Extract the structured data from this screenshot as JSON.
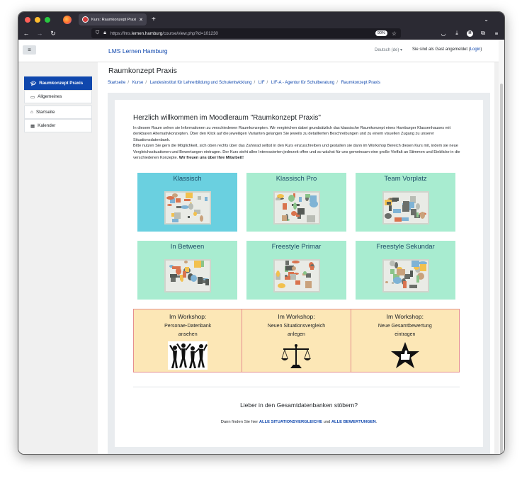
{
  "browser": {
    "tab_title": "Kurs: Raumkonzept Praxis",
    "url_prefix": "https://lms.",
    "url_domain": "lernen.hamburg",
    "url_suffix": "/course/view.php?id=101230",
    "zoom": "90%",
    "profile_initial": "M"
  },
  "header": {
    "site_name": "LMS Lernen Hamburg",
    "language": "Deutsch (de) ▾",
    "guest_text": "Sie sind als Gast angemeldet (",
    "login_label": "Login",
    "guest_close": ")"
  },
  "sidebar": {
    "items": [
      {
        "label": "Raumkonzept Praxis",
        "icon": "graduation-cap-icon"
      },
      {
        "label": "Allgemeines",
        "icon": "folder-icon"
      },
      {
        "label": "Startseite",
        "icon": "home-icon"
      },
      {
        "label": "Kalender",
        "icon": "calendar-icon"
      }
    ]
  },
  "page": {
    "title": "Raumkonzept Praxis",
    "breadcrumbs": [
      "Startseite",
      "Kurse",
      "Landesinstitut für Lehrerbildung und Schulentwicklung",
      "LIF",
      "LIF-A - Agentur für Schulberatung",
      "Raumkonzept Praxis"
    ]
  },
  "content": {
    "welcome_title": "Herzlich willkommen im Moodleraum \"Raumkonzept Praxis\"",
    "intro_1": "In diesem Raum sehen sie Informationen zu verschiedenen Raumkonzepten. Wir vergleichen dabei grundsätzlich das klassische Raumkonzept eines Hamburger Klassenhauses mit denkbaren Alternativkonzepten. Über den Klick auf die jeweiligen Varianten gelangen Sie jeweils zu detaillierten Beschreibungen und zu einem visuellen Zugang zu unserer Situationsdatenbank.",
    "intro_2": "Bitte nutzen Sie gern die Möglichkeit, sich oben rechts über das Zahnrad selbst in den Kurs einzuschreiben und gestalten sie dann im Workshop Bereich diesen Kurs mit, indem sie neue Vergleichssituationen und Bewertungen eintragen. Der Kurs steht allen Interessierten jederzeit offen und so wächst für uns gemeinsam eine große Vielfalt an Stimmen und Einblicke in die verschiedenen Konzepte. ",
    "intro_bold": "Wir freuen uns über Ihre Mitarbeit!",
    "tiles": [
      {
        "label": "Klassisch",
        "color": "#6ad0e0"
      },
      {
        "label": "Klassisch Pro",
        "color": "#a8ecd0"
      },
      {
        "label": "Team Vorplatz",
        "color": "#a8ecd0"
      },
      {
        "label": "In Between",
        "color": "#a8ecd0"
      },
      {
        "label": "Freestyle Primar",
        "color": "#a8ecd0"
      },
      {
        "label": "Freestyle Sekundar",
        "color": "#a8ecd0"
      }
    ],
    "workshops": [
      {
        "title": "Im Workshop:",
        "line1": "Personae-Datenbank",
        "line2": "ansehen"
      },
      {
        "title": "Im Workshop:",
        "line1": "Neuen Situationsvergleich",
        "line2": "anlegen"
      },
      {
        "title": "Im Workshop:",
        "line1": "Neue Gesamtbewertung",
        "line2": "eintragen"
      }
    ],
    "lieber": "Lieber in den Gesamtdatenbanken stöbern?",
    "dann_prefix": "Dann finden Sie hier ",
    "link_situationen": "ALLE SITUATIONSVERGLEICHE",
    "dann_mid": " und ",
    "link_bewertungen": "ALLE BEWERTUNGEN",
    "dann_end": "."
  },
  "colors": {
    "accent": "#0f47ad",
    "tile_highlight": "#6ad0e0",
    "tile_default": "#a8ecd0",
    "workshop_bg": "#fce7b6"
  }
}
